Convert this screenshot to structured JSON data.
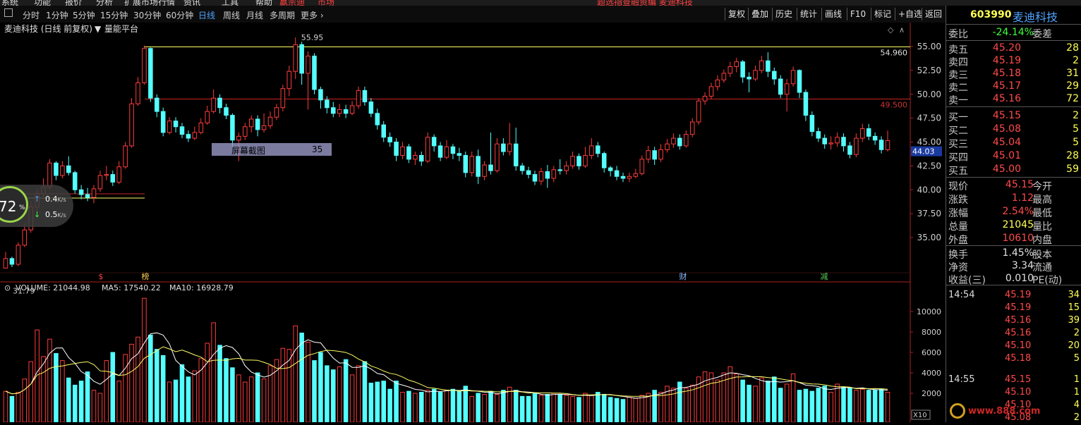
{
  "menubar": {
    "items": [
      "系统",
      "功能",
      "报价",
      "分析",
      "扩展市场行情",
      "资讯",
      "工具",
      "帮助",
      "赢宗迪",
      "市场"
    ],
    "notice": "题选指查融资编 麦迪科技"
  },
  "toolbar": {
    "periods": [
      "分时",
      "1分钟",
      "5分钟",
      "15分钟",
      "30分钟",
      "60分钟",
      "日线",
      "周线",
      "月线",
      "多周期",
      "更多 ›"
    ],
    "active_period": "日线",
    "right_buttons": [
      "复权",
      "叠加",
      "历史",
      "统计",
      "画线",
      "F10",
      "标记",
      "+自选",
      "返回"
    ]
  },
  "chart": {
    "title": "麦迪科技 (日线 前复权)",
    "indicator": "量能平台",
    "high_label": "55.95",
    "low_label": "31.79",
    "line1_value": "54.960",
    "line2_value": "49.500",
    "current_price_tag": "44.03",
    "price_axis": [
      "55.00",
      "52.50",
      "50.00",
      "47.50",
      "45.00",
      "42.50",
      "40.00",
      "37.50",
      "35.00"
    ],
    "markers": [
      "$",
      "榜",
      "财",
      "减"
    ],
    "volume_title": "VOLUME: 21044.98",
    "ma5_label": "MA5: 17540.22",
    "ma10_label": "MA10: 16928.79",
    "volume_axis": [
      "10000",
      "8000",
      "6000",
      "4000",
      "2000"
    ],
    "volume_unit": "X10",
    "colors": {
      "up": "#ff3c3c",
      "down": "#54ffff",
      "line_yellow": "#ffff66",
      "line_red": "#cc2222",
      "ma": "#ffffff",
      "ma10": "#ffff66"
    }
  },
  "chart_data": {
    "type": "candlestick",
    "price_range": [
      33,
      57
    ],
    "volume_range": [
      0,
      11500
    ],
    "candles": [
      [
        31.8,
        32.8,
        33.5,
        31.8
      ],
      [
        32.8,
        32.2,
        33.0,
        31.9
      ],
      [
        32.2,
        34.2,
        34.5,
        32.0
      ],
      [
        34.2,
        35.8,
        36.5,
        34.0
      ],
      [
        35.8,
        38.2,
        38.8,
        35.5
      ],
      [
        38.2,
        39.6,
        40.0,
        37.8
      ],
      [
        39.6,
        40.3,
        41.2,
        39.2
      ],
      [
        40.3,
        42.8,
        43.2,
        40.0
      ],
      [
        42.8,
        41.5,
        43.0,
        41.0
      ],
      [
        41.5,
        42.5,
        43.0,
        41.2
      ],
      [
        42.5,
        41.8,
        43.5,
        41.5
      ],
      [
        41.8,
        40.0,
        42.0,
        39.6
      ],
      [
        40.0,
        39.5,
        40.5,
        39.0
      ],
      [
        39.5,
        39.2,
        40.2,
        38.8
      ],
      [
        39.2,
        40.1,
        40.5,
        38.6
      ],
      [
        40.1,
        41.5,
        42.0,
        39.8
      ],
      [
        41.5,
        41.6,
        42.5,
        41.0
      ],
      [
        41.6,
        40.8,
        42.0,
        40.4
      ],
      [
        40.8,
        42.4,
        43.0,
        40.6
      ],
      [
        42.4,
        44.6,
        45.0,
        42.2
      ],
      [
        44.6,
        49.0,
        49.6,
        44.4
      ],
      [
        49.0,
        51.2,
        51.8,
        48.8
      ],
      [
        51.2,
        54.8,
        55.1,
        51.0
      ],
      [
        54.8,
        49.6,
        54.9,
        49.2
      ],
      [
        49.6,
        48.2,
        50.0,
        47.6
      ],
      [
        48.2,
        46.0,
        48.6,
        45.6
      ],
      [
        46.0,
        47.2,
        47.6,
        45.8
      ],
      [
        47.2,
        46.6,
        47.6,
        46.0
      ],
      [
        46.6,
        45.8,
        47.0,
        45.4
      ],
      [
        45.8,
        45.4,
        46.2,
        45.0
      ],
      [
        45.4,
        46.0,
        46.6,
        45.2
      ],
      [
        46.0,
        47.0,
        47.5,
        45.8
      ],
      [
        47.0,
        48.2,
        48.8,
        46.8
      ],
      [
        48.2,
        49.6,
        50.5,
        48.0
      ],
      [
        49.6,
        48.6,
        50.0,
        48.0
      ],
      [
        48.6,
        47.8,
        49.0,
        47.4
      ],
      [
        47.8,
        45.2,
        48.0,
        44.4
      ],
      [
        45.2,
        45.6,
        46.0,
        43.0
      ],
      [
        45.6,
        46.6,
        47.0,
        45.2
      ],
      [
        46.6,
        47.4,
        47.8,
        46.0
      ],
      [
        47.4,
        46.3,
        47.8,
        45.6
      ],
      [
        46.3,
        46.7,
        48.0,
        46.0
      ],
      [
        46.7,
        47.6,
        48.2,
        46.4
      ],
      [
        47.6,
        48.6,
        49.0,
        47.3
      ],
      [
        48.6,
        50.6,
        51.0,
        48.2
      ],
      [
        50.6,
        52.4,
        53.0,
        49.8
      ],
      [
        52.4,
        55.2,
        55.95,
        51.6
      ],
      [
        55.2,
        52.2,
        55.5,
        51.0
      ],
      [
        52.2,
        54.0,
        54.5,
        48.4
      ],
      [
        54.0,
        50.5,
        54.3,
        50.0
      ],
      [
        50.5,
        49.4,
        50.8,
        48.5
      ],
      [
        49.4,
        48.6,
        49.8,
        48.0
      ],
      [
        48.6,
        48.0,
        49.2,
        47.6
      ],
      [
        48.0,
        48.4,
        49.0,
        47.6
      ],
      [
        48.4,
        48.0,
        48.9,
        47.5
      ],
      [
        48.0,
        48.8,
        49.3,
        47.8
      ],
      [
        48.8,
        50.4,
        50.8,
        48.5
      ],
      [
        50.4,
        49.2,
        50.8,
        48.8
      ],
      [
        49.2,
        48.0,
        49.6,
        47.6
      ],
      [
        48.0,
        46.8,
        48.5,
        46.3
      ],
      [
        46.8,
        45.5,
        47.2,
        45.0
      ],
      [
        45.5,
        45.0,
        46.0,
        44.5
      ],
      [
        45.0,
        43.6,
        45.4,
        43.0
      ],
      [
        43.6,
        44.5,
        45.0,
        43.2
      ],
      [
        44.5,
        43.2,
        44.8,
        42.8
      ],
      [
        43.2,
        43.6,
        44.0,
        42.6
      ],
      [
        43.6,
        43.0,
        44.0,
        42.5
      ],
      [
        43.0,
        45.5,
        46.0,
        42.8
      ],
      [
        45.5,
        44.6,
        45.8,
        44.0
      ],
      [
        44.6,
        43.4,
        45.0,
        43.0
      ],
      [
        43.4,
        44.5,
        45.2,
        43.2
      ],
      [
        44.5,
        43.8,
        44.8,
        43.2
      ],
      [
        43.8,
        43.6,
        44.4,
        43.0
      ],
      [
        43.6,
        41.8,
        44.0,
        41.3
      ],
      [
        41.8,
        43.5,
        44.0,
        41.4
      ],
      [
        43.5,
        41.4,
        44.2,
        40.6
      ],
      [
        41.4,
        42.6,
        43.0,
        41.0
      ],
      [
        42.6,
        42.0,
        46.0,
        41.6
      ],
      [
        42.0,
        44.8,
        45.4,
        41.8
      ],
      [
        44.8,
        44.0,
        45.4,
        43.6
      ],
      [
        44.0,
        44.8,
        47.0,
        43.6
      ],
      [
        44.8,
        42.5,
        46.5,
        42.0
      ],
      [
        42.5,
        42.0,
        42.8,
        41.6
      ],
      [
        42.0,
        41.6,
        42.4,
        41.2
      ],
      [
        41.6,
        40.9,
        42.0,
        40.5
      ],
      [
        40.9,
        41.9,
        42.3,
        40.5
      ],
      [
        41.9,
        41.2,
        42.6,
        40.2
      ],
      [
        41.2,
        42.1,
        42.5,
        40.8
      ],
      [
        42.1,
        42.0,
        43.2,
        41.6
      ],
      [
        42.0,
        42.5,
        43.0,
        41.6
      ],
      [
        42.5,
        43.5,
        44.0,
        42.2
      ],
      [
        43.5,
        42.5,
        43.8,
        42.1
      ],
      [
        42.5,
        43.6,
        44.5,
        42.3
      ],
      [
        43.6,
        44.6,
        45.4,
        43.2
      ],
      [
        44.6,
        43.8,
        45.0,
        43.4
      ],
      [
        43.8,
        42.3,
        44.0,
        41.8
      ],
      [
        42.3,
        42.0,
        42.5,
        41.4
      ],
      [
        42.0,
        41.4,
        42.5,
        41.0
      ],
      [
        41.4,
        41.2,
        41.8,
        40.8
      ],
      [
        41.2,
        41.4,
        41.8,
        40.8
      ],
      [
        41.4,
        41.7,
        42.2,
        41.2
      ],
      [
        41.7,
        43.2,
        43.6,
        41.5
      ],
      [
        43.2,
        44.1,
        44.6,
        42.8
      ],
      [
        44.1,
        43.2,
        44.5,
        42.6
      ],
      [
        43.2,
        44.2,
        44.8,
        42.9
      ],
      [
        44.2,
        44.8,
        45.3,
        43.9
      ],
      [
        44.8,
        45.4,
        45.9,
        44.4
      ],
      [
        45.4,
        44.6,
        45.8,
        44.2
      ],
      [
        44.6,
        45.8,
        46.2,
        44.4
      ],
      [
        45.8,
        47.1,
        47.5,
        45.5
      ],
      [
        47.1,
        49.3,
        49.6,
        46.8
      ],
      [
        49.3,
        49.8,
        50.2,
        48.9
      ],
      [
        49.8,
        50.8,
        51.2,
        49.5
      ],
      [
        50.8,
        51.5,
        52.0,
        50.4
      ],
      [
        51.5,
        52.2,
        52.6,
        51.2
      ],
      [
        52.2,
        52.9,
        53.4,
        51.8
      ],
      [
        52.9,
        53.4,
        53.8,
        52.3
      ],
      [
        53.4,
        51.8,
        53.6,
        51.2
      ],
      [
        51.8,
        51.6,
        52.3,
        50.2
      ],
      [
        51.6,
        52.5,
        53.0,
        51.4
      ],
      [
        52.5,
        53.5,
        54.0,
        52.2
      ],
      [
        53.5,
        52.4,
        54.4,
        51.8
      ],
      [
        52.4,
        51.6,
        52.8,
        51.0
      ],
      [
        51.6,
        50.0,
        52.0,
        49.6
      ],
      [
        50.0,
        51.1,
        51.6,
        48.2
      ],
      [
        51.1,
        52.5,
        52.9,
        50.8
      ],
      [
        52.5,
        50.2,
        52.6,
        49.6
      ],
      [
        50.2,
        47.8,
        50.5,
        47.2
      ],
      [
        47.8,
        46.1,
        48.2,
        45.6
      ],
      [
        46.1,
        45.4,
        46.5,
        45.0
      ],
      [
        45.4,
        44.8,
        45.8,
        44.3
      ],
      [
        44.8,
        44.9,
        45.6,
        44.2
      ],
      [
        44.9,
        45.5,
        46.0,
        44.5
      ],
      [
        45.5,
        44.6,
        45.9,
        44.0
      ],
      [
        44.6,
        43.7,
        45.0,
        43.3
      ],
      [
        43.7,
        45.4,
        45.9,
        43.4
      ],
      [
        45.4,
        46.4,
        46.9,
        45.0
      ],
      [
        46.4,
        45.6,
        46.9,
        45.2
      ],
      [
        45.6,
        45.2,
        46.0,
        44.7
      ],
      [
        45.2,
        44.2,
        45.6,
        43.8
      ],
      [
        44.2,
        45.15,
        46.2,
        44.0
      ]
    ],
    "volumes": [
      2200,
      1700,
      2100,
      3400,
      5100,
      8200,
      5600,
      7300,
      5900,
      5200,
      3500,
      2800,
      3200,
      4100,
      2300,
      2000,
      5200,
      6000,
      3200,
      5800,
      6800,
      7500,
      11300,
      7700,
      6300,
      5700,
      3100,
      3300,
      4800,
      3600,
      4200,
      5400,
      6900,
      8900,
      6700,
      5400,
      4500,
      3800,
      3100,
      3600,
      4000,
      3400,
      4700,
      5300,
      6400,
      6300,
      8600,
      7900,
      7000,
      5200,
      6000,
      4700,
      4300,
      4600,
      5300,
      3800,
      4700,
      5100,
      3000,
      3100,
      3200,
      2400,
      3200,
      2100,
      2200,
      2000,
      2100,
      2300,
      2400,
      2100,
      2300,
      2400,
      2200,
      2700,
      1700,
      2000,
      1900,
      2200,
      1900,
      2300,
      2600,
      2300,
      1700,
      1700,
      2000,
      1800,
      1900,
      2000,
      1900,
      1800,
      1700,
      1600,
      2000,
      1800,
      2100,
      1900,
      1600,
      1500,
      1400,
      1600,
      1500,
      1800,
      2000,
      2300,
      2100,
      2700,
      2500,
      3100,
      2500,
      2800,
      3600,
      4100,
      4000,
      3300,
      4000,
      4600,
      3900,
      3300,
      2800,
      2700,
      3500,
      3200,
      3600,
      2500,
      2900,
      3900,
      2300,
      2400,
      2200,
      2500,
      2700,
      2100,
      2900,
      2600,
      2500,
      2300,
      2400,
      2300,
      2300,
      2400,
      2100
    ]
  },
  "speed_widget": {
    "percent": "72",
    "sign": "%",
    "up_speed": "0.4",
    "up_unit": "K/s",
    "down_speed": "0.5",
    "down_unit": "K/s"
  },
  "tooltip": {
    "label": "屏幕截图",
    "value": "35"
  },
  "panel": {
    "code": "603990",
    "name": "麦迪科技",
    "weibi_label": "委比",
    "weibi_value": "-24.14%",
    "weicha_label": "委差",
    "asks": [
      {
        "label": "卖五",
        "price": "45.20",
        "qty": "28"
      },
      {
        "label": "卖四",
        "price": "45.19",
        "qty": "2"
      },
      {
        "label": "卖三",
        "price": "45.18",
        "qty": "31"
      },
      {
        "label": "卖二",
        "price": "45.17",
        "qty": "29"
      },
      {
        "label": "卖一",
        "price": "45.16",
        "qty": "72"
      }
    ],
    "bids": [
      {
        "label": "买一",
        "price": "45.15",
        "qty": "2"
      },
      {
        "label": "买二",
        "price": "45.08",
        "qty": "5"
      },
      {
        "label": "买三",
        "price": "45.04",
        "qty": "5"
      },
      {
        "label": "买四",
        "price": "45.01",
        "qty": "28"
      },
      {
        "label": "买五",
        "price": "45.00",
        "qty": "59"
      }
    ],
    "stats": [
      {
        "label": "现价",
        "value": "45.15",
        "label2": "今开",
        "color": "red"
      },
      {
        "label": "涨跌",
        "value": "1.12",
        "label2": "最高",
        "color": "red"
      },
      {
        "label": "涨幅",
        "value": "2.54%",
        "label2": "最低",
        "color": "red"
      },
      {
        "label": "总量",
        "value": "21045",
        "label2": "量比",
        "color": "yel"
      },
      {
        "label": "外盘",
        "value": "10610",
        "label2": "内盘",
        "color": "red"
      }
    ],
    "stats2": [
      {
        "label": "换手",
        "value": "1.45%",
        "label2": "股本"
      },
      {
        "label": "净资",
        "value": "3.34",
        "label2": "流通"
      },
      {
        "label": "收益(三)",
        "value": "0.010",
        "label2": "PE(动)"
      }
    ],
    "ticks": [
      {
        "time": "14:54",
        "price": "45.19",
        "vol": "34"
      },
      {
        "time": "",
        "price": "45.19",
        "vol": "15"
      },
      {
        "time": "",
        "price": "45.16",
        "vol": "39"
      },
      {
        "time": "",
        "price": "45.16",
        "vol": "2"
      },
      {
        "time": "",
        "price": "45.10",
        "vol": "20"
      },
      {
        "time": "",
        "price": "45.18",
        "vol": "5"
      },
      {
        "time": "14:55",
        "price": "45.15",
        "vol": "1"
      },
      {
        "time": "",
        "price": "45.10",
        "vol": "1"
      },
      {
        "time": "",
        "price": "45.10",
        "vol": "4"
      },
      {
        "time": "",
        "price": "45.08",
        "vol": "2"
      }
    ],
    "watermark": "www.888.com"
  }
}
